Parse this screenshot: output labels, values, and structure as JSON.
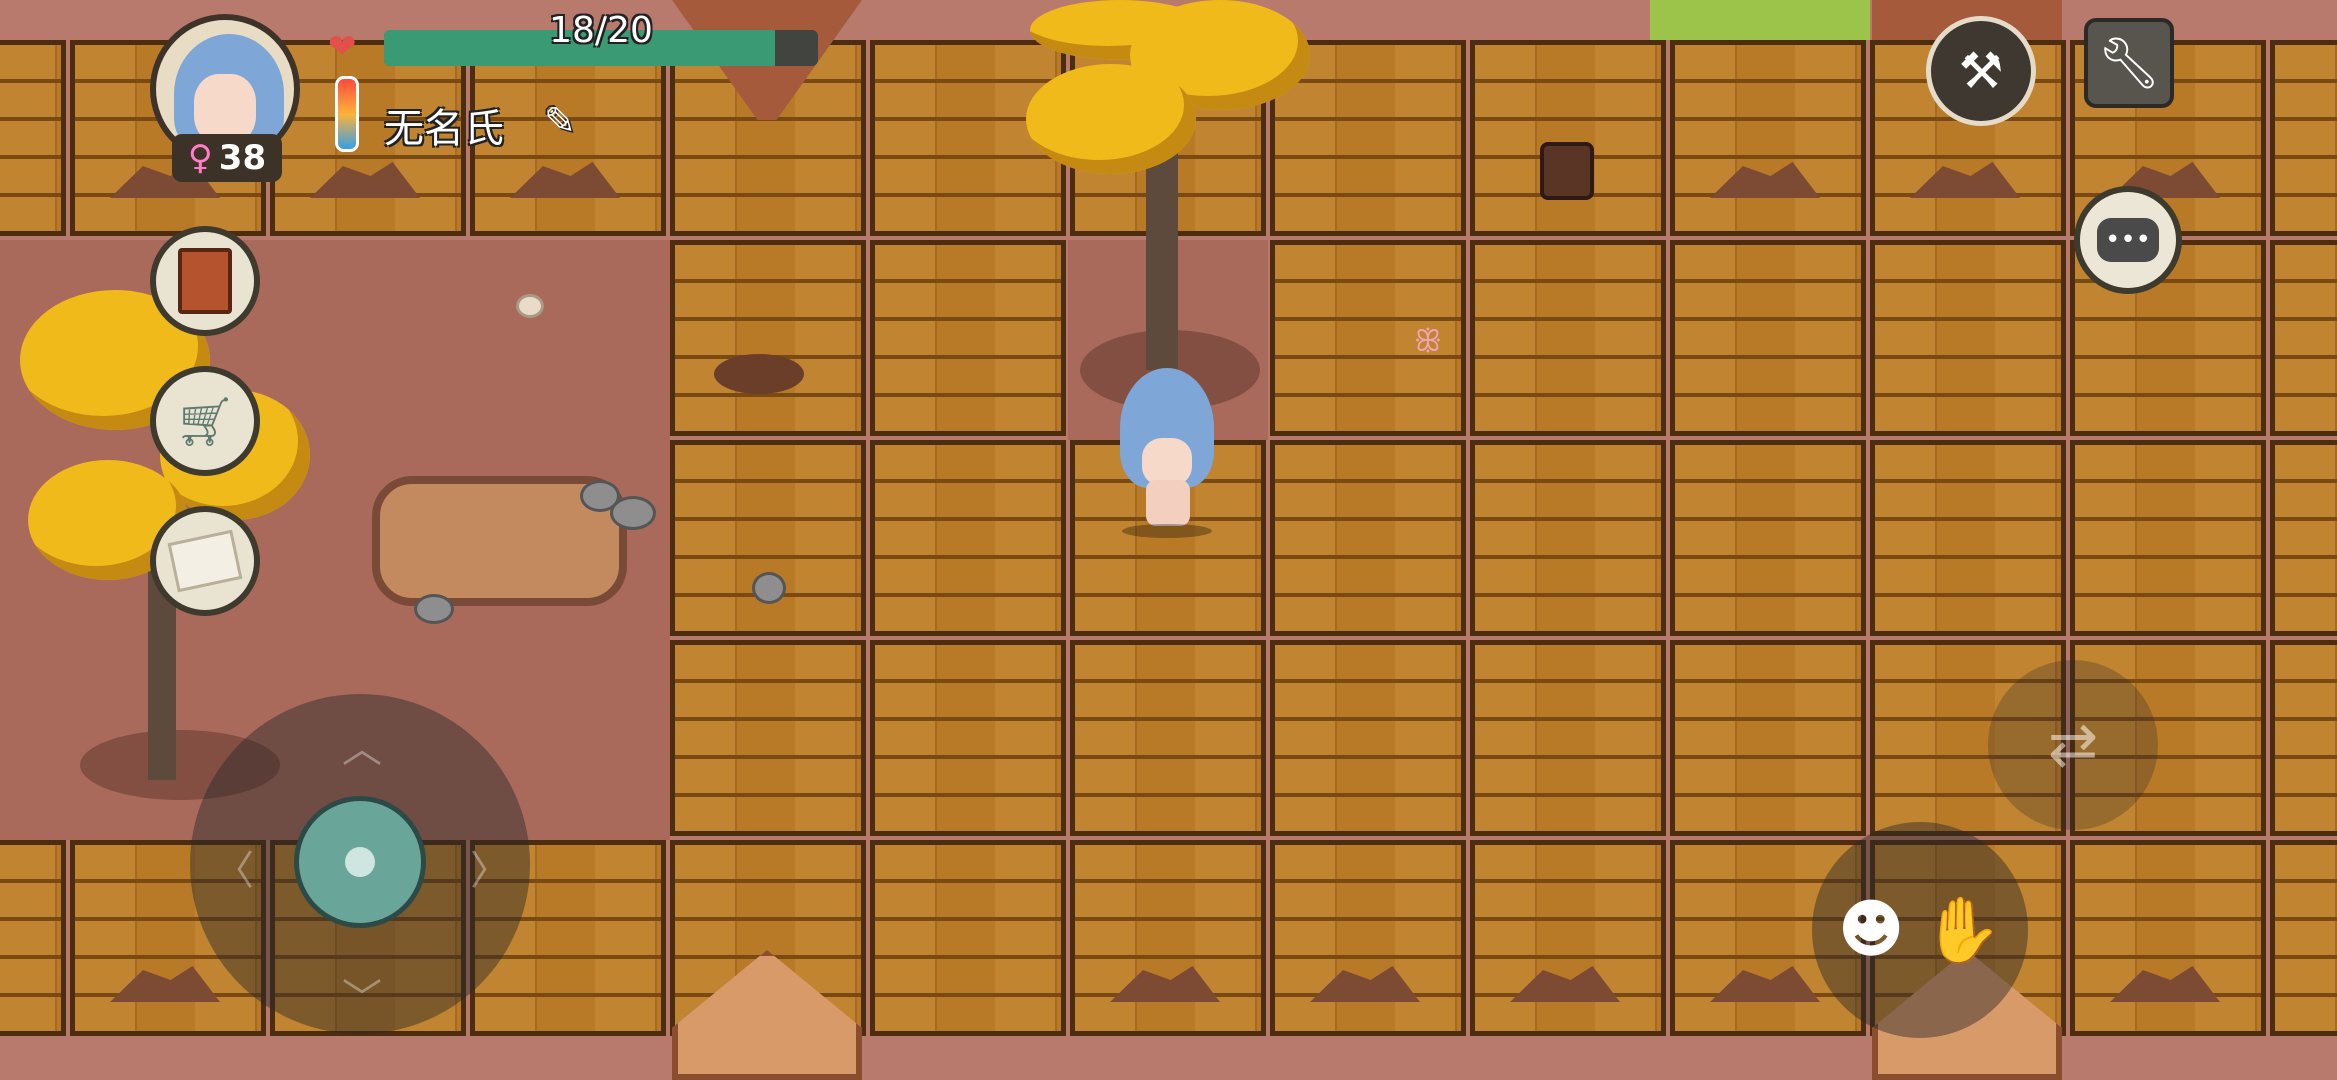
{
  "hud": {
    "hp_text": "18/20",
    "hp_value": 18,
    "hp_max": 20,
    "hp_fraction": 0.9,
    "player_name": "无名氏",
    "age_symbol": "♀",
    "age": "38"
  },
  "icons": {
    "heart": "heart-icon",
    "thermometer": "thermometer-icon",
    "edit": "pencil-icon",
    "journal": "book-icon",
    "shop": "cart-icon",
    "map": "map-icon",
    "build": "hammer-icon",
    "settings": "wrench-icon",
    "chat": "chat-bubble-icon",
    "swap_interact": "swap-pick-up-icon",
    "emote_slap": "emote-slap-icon"
  },
  "colors": {
    "hp_fill": "#3a9a74",
    "hp_track": "#42443f",
    "plank": "#b97a28",
    "ground": "#b87a6c",
    "tree": "#f0bb1a"
  }
}
